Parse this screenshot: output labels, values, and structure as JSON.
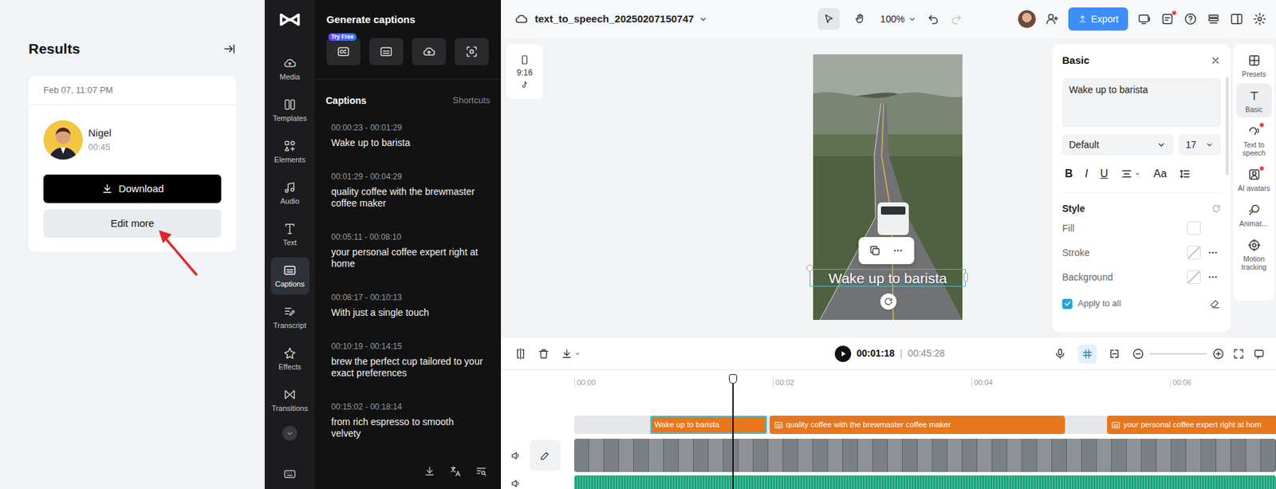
{
  "results": {
    "title": "Results",
    "date": "Feb 07, 11:07 PM",
    "name": "Nigel",
    "duration": "00:45",
    "download": "Download",
    "edit_more": "Edit more"
  },
  "nav": [
    {
      "label": "Media",
      "selected": false
    },
    {
      "label": "Templates",
      "selected": false
    },
    {
      "label": "Elements",
      "selected": false
    },
    {
      "label": "Audio",
      "selected": false
    },
    {
      "label": "Text",
      "selected": false
    },
    {
      "label": "Captions",
      "selected": true
    },
    {
      "label": "Transcript",
      "selected": false
    },
    {
      "label": "Effects",
      "selected": false
    },
    {
      "label": "Transitions",
      "selected": false
    }
  ],
  "captions_panel": {
    "title": "Generate captions",
    "badge": "Try Free",
    "heading": "Captions",
    "shortcuts": "Shortcuts",
    "items": [
      {
        "time": "00:00:23 - 00:01:29",
        "text": "Wake up to barista"
      },
      {
        "time": "00:01:29 - 00:04:29",
        "text": "quality coffee with the brewmaster coffee maker"
      },
      {
        "time": "00:05:11 - 00:08:10",
        "text": "your personal coffee expert right at home"
      },
      {
        "time": "00:08:17 - 00:10:13",
        "text": "With just a single touch"
      },
      {
        "time": "00:10:19 - 00:14:15",
        "text": "brew the perfect cup tailored to your exact preferences"
      },
      {
        "time": "00:15:02 - 00:18:14",
        "text": "from rich espresso to smooth velvety"
      }
    ]
  },
  "topbar": {
    "project": "text_to_speech_20250207150747",
    "tools": [
      {
        "selected": true
      },
      {
        "selected": false
      }
    ],
    "zoom": "100%",
    "history": [
      {
        "disabled": false
      },
      {
        "disabled": true
      }
    ],
    "export": "Export",
    "icons": [
      {
        "dot": false
      },
      {
        "dot": true
      },
      {
        "dot": false
      },
      {
        "dot": false
      },
      {
        "dot": false
      },
      {
        "dot": false
      }
    ]
  },
  "preview": {
    "ratio": "9:16",
    "caption": "Wake up to barista",
    "selected": true
  },
  "properties": {
    "title": "Basic",
    "text": "Wake up to barista",
    "font": "Default",
    "size": "17",
    "format": {
      "bold": "B",
      "italic": "I",
      "underline": "U",
      "case": "Aa"
    },
    "style_title": "Style",
    "rows": [
      {
        "label": "Fill",
        "empty": false,
        "more": false
      },
      {
        "label": "Stroke",
        "empty": true,
        "more": true
      },
      {
        "label": "Background",
        "empty": true,
        "more": true
      }
    ],
    "apply_all": {
      "label": "Apply to all",
      "checked": true
    }
  },
  "rail": [
    {
      "label": "Presets",
      "selected": false,
      "dot": false
    },
    {
      "label": "Basic",
      "selected": true,
      "dot": false
    },
    {
      "label": "Text to speech",
      "selected": false,
      "dot": true
    },
    {
      "label": "AI avatars",
      "selected": false,
      "dot": true
    },
    {
      "label": "Animat…",
      "selected": false,
      "dot": false
    },
    {
      "label": "Motion tracking",
      "selected": false,
      "dot": false
    }
  ],
  "player": {
    "current": "00:01:18",
    "divider": "|",
    "total": "00:45:28",
    "right_tools": [
      {
        "selected": false
      },
      {
        "selected": true
      },
      {
        "selected": false
      }
    ]
  },
  "timeline": {
    "ticks": [
      "00:00",
      "00:02",
      "00:04",
      "00:06"
    ],
    "clips": [
      {
        "text": "Wake up to barista",
        "selected": true
      },
      {
        "text": "quality coffee with the brewmaster coffee maker",
        "selected": false
      },
      {
        "text": "your personal coffee expert right at hom",
        "selected": false
      }
    ]
  }
}
